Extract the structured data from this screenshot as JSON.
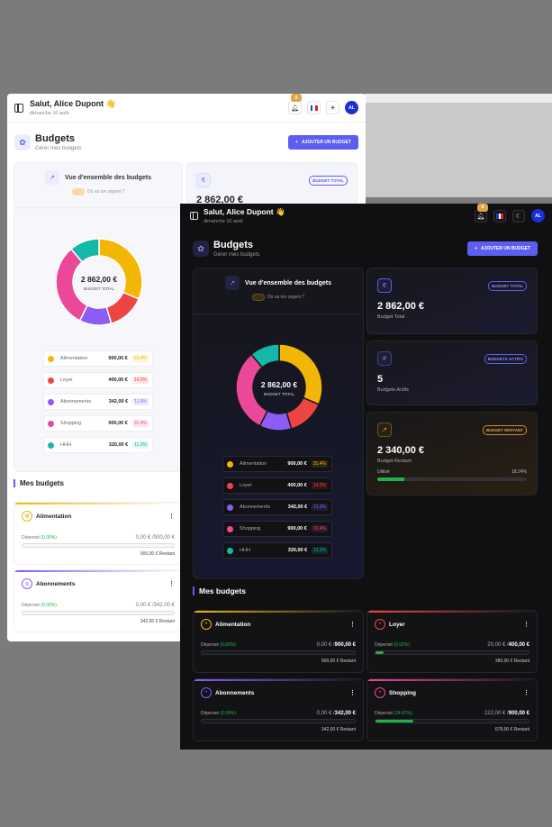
{
  "greeting": "Salut, Alice Dupont 👋",
  "date": "dimanche 10 août",
  "notification_count": "6",
  "avatar_initials": "AL",
  "icons": {
    "sidebar": "sidebar-toggle-icon",
    "bell": "bell-icon",
    "flag": "french-flag-icon",
    "theme_light": "sun-icon",
    "theme_dark": "moon-icon",
    "piggy": "piggy-bank-icon",
    "trend": "trend-up-icon",
    "euro": "euro-icon",
    "hash": "hash-icon",
    "menu": "more-vertical-icon"
  },
  "page": {
    "title": "Budgets",
    "subtitle": "Gérer mes budgets",
    "add_button": "AJOUTER UN BUDGET"
  },
  "overview": {
    "title": "Vue d'ensemble des budgets",
    "subtitle": "Où va ton argent ?",
    "center_value": "2 862,00 €",
    "center_label": "BUDGET TOTAL"
  },
  "categories": [
    {
      "name": "Alimentation",
      "amount": "900,00 €",
      "pct": "31.4%",
      "value": 900,
      "color": "#f2b705"
    },
    {
      "name": "Loyer",
      "amount": "400,00 €",
      "pct": "14.0%",
      "value": 400,
      "color": "#ef4444"
    },
    {
      "name": "Abonnements",
      "amount": "342,00 €",
      "pct": "11.9%",
      "value": 342,
      "color": "#8b5cf6"
    },
    {
      "name": "Shopping",
      "amount": "900,00 €",
      "pct": "31.4%",
      "value": 900,
      "color": "#ec4899"
    },
    {
      "name": "HHH",
      "amount": "320,00 €",
      "pct": "11.2%",
      "value": 320,
      "color": "#14b8a6"
    }
  ],
  "stats": {
    "total": {
      "badge": "BUDGET TOTAL",
      "value": "2 862,00 €",
      "label": "Budget Total"
    },
    "active": {
      "badge": "BUDGETS ACTIFS",
      "value": "5",
      "label": "Budgets Actifs"
    },
    "remaining": {
      "badge": "BUDGET RESTANT",
      "value": "2 340,00 €",
      "label": "Budget Restant",
      "used_label": "Utilisé",
      "used_pct": "18.24%",
      "used_fraction": 0.1824
    }
  },
  "mes_budgets_title": "Mes budgets",
  "budgets": [
    {
      "name": "Alimentation",
      "spent_label": "Dépensé",
      "spent_pct": "(0.00%)",
      "amounts": "0,00 € / 900,00 €",
      "amounts_left": "0,00 € / ",
      "amounts_right": "900,00 €",
      "remaining": "900,00 € Restant",
      "fill": 0.0,
      "color": "#f2b705",
      "icon": "utensils-icon"
    },
    {
      "name": "Loyer",
      "spent_label": "Dépensé",
      "spent_pct": "(0.00%)",
      "amounts_left": "20,00 € / ",
      "amounts_right": "400,00 €",
      "remaining": "380,00 € Restant",
      "fill": 0.05,
      "color": "#ef4444",
      "icon": "home-icon"
    },
    {
      "name": "Abonnements",
      "spent_label": "Dépensé",
      "spent_pct": "(0.00%)",
      "amounts_left": "0,00 € / ",
      "amounts_right": "342,00 €",
      "remaining": "342,00 € Restant",
      "fill": 0.0,
      "color": "#8b5cf6",
      "icon": "wifi-icon"
    },
    {
      "name": "Shopping",
      "spent_label": "Dépensé",
      "spent_pct": "(24.67%)",
      "amounts_left": "222,00 € / ",
      "amounts_right": "900,00 €",
      "remaining": "678,00 € Restant",
      "fill": 0.2467,
      "color": "#ec4899",
      "icon": "cart-icon"
    }
  ],
  "light_budgets": [
    {
      "name": "Alimentation",
      "amounts_left": "0,00 € / ",
      "amounts_right": "900,00 €",
      "remaining": "900,00 € Restant"
    },
    {
      "name": "Abonnements",
      "amounts_left": "0,00 € / ",
      "amounts_right": "342,00 €",
      "remaining": "342,00 € Restant"
    }
  ]
}
